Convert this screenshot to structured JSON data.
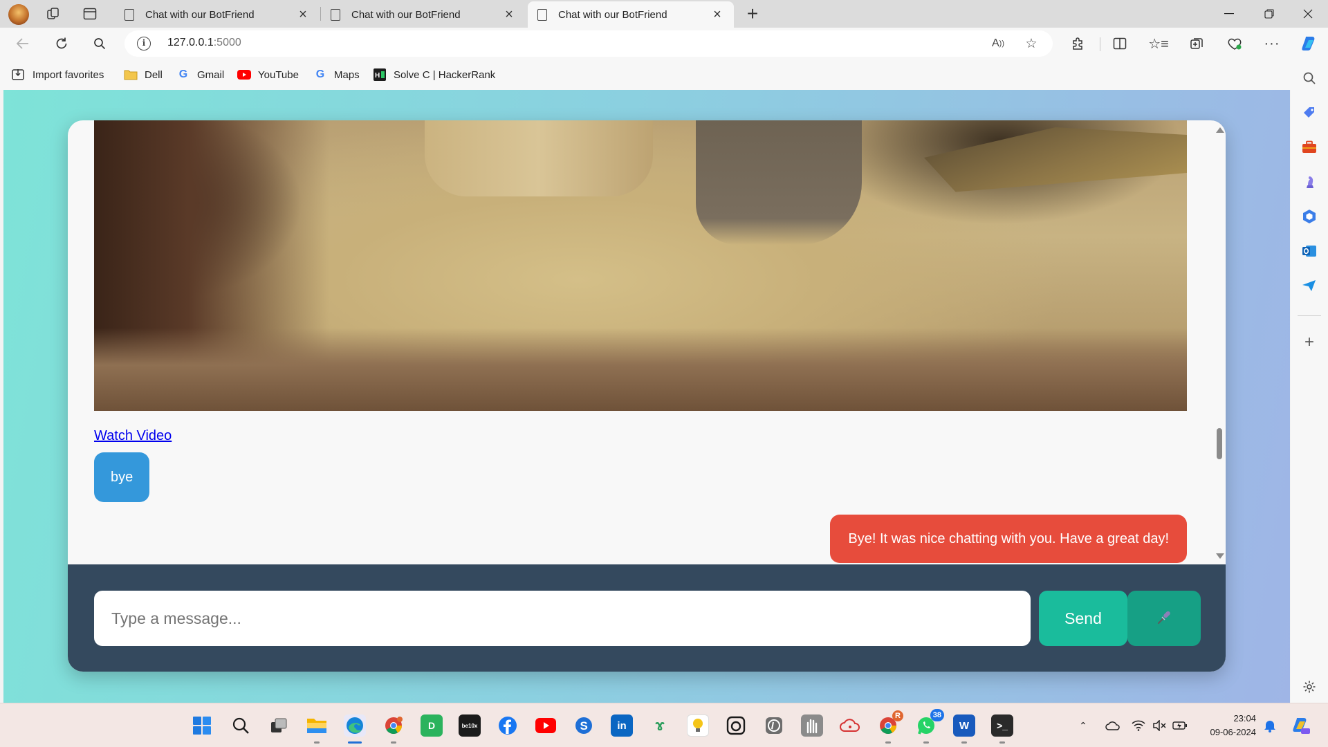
{
  "browser": {
    "tabs": [
      {
        "title": "Chat with our BotFriend",
        "active": false
      },
      {
        "title": "Chat with our BotFriend",
        "active": false
      },
      {
        "title": "Chat with our BotFriend",
        "active": true
      }
    ],
    "address": {
      "host": "127.0.0.1",
      "port": ":5000"
    },
    "favorites": [
      {
        "label": "Import favorites",
        "icon": "import-icon"
      },
      {
        "label": "Dell",
        "icon": "folder-icon"
      },
      {
        "label": "Gmail",
        "icon": "google-icon"
      },
      {
        "label": "YouTube",
        "icon": "youtube-icon"
      },
      {
        "label": "Maps",
        "icon": "google-icon"
      },
      {
        "label": "Solve C | HackerRank",
        "icon": "hackerrank-icon"
      }
    ]
  },
  "chat": {
    "image": {
      "alt": "media-image"
    },
    "link_text": "Watch Video",
    "messages": [
      {
        "sender": "user",
        "text": "bye"
      },
      {
        "sender": "bot",
        "text": "Bye! It was nice chatting with you. Have a great day!"
      }
    ],
    "input_placeholder": "Type a message...",
    "send_label": "Send",
    "colors": {
      "user_bubble": "#3498db",
      "bot_bubble": "#e74c3c",
      "footer": "#34495e",
      "send": "#1abc9c",
      "mic": "#16a085"
    }
  },
  "taskbar": {
    "whatsapp_badge": "38",
    "app_badge": "R",
    "clock_time": "23:04",
    "clock_date": "09-06-2024"
  }
}
